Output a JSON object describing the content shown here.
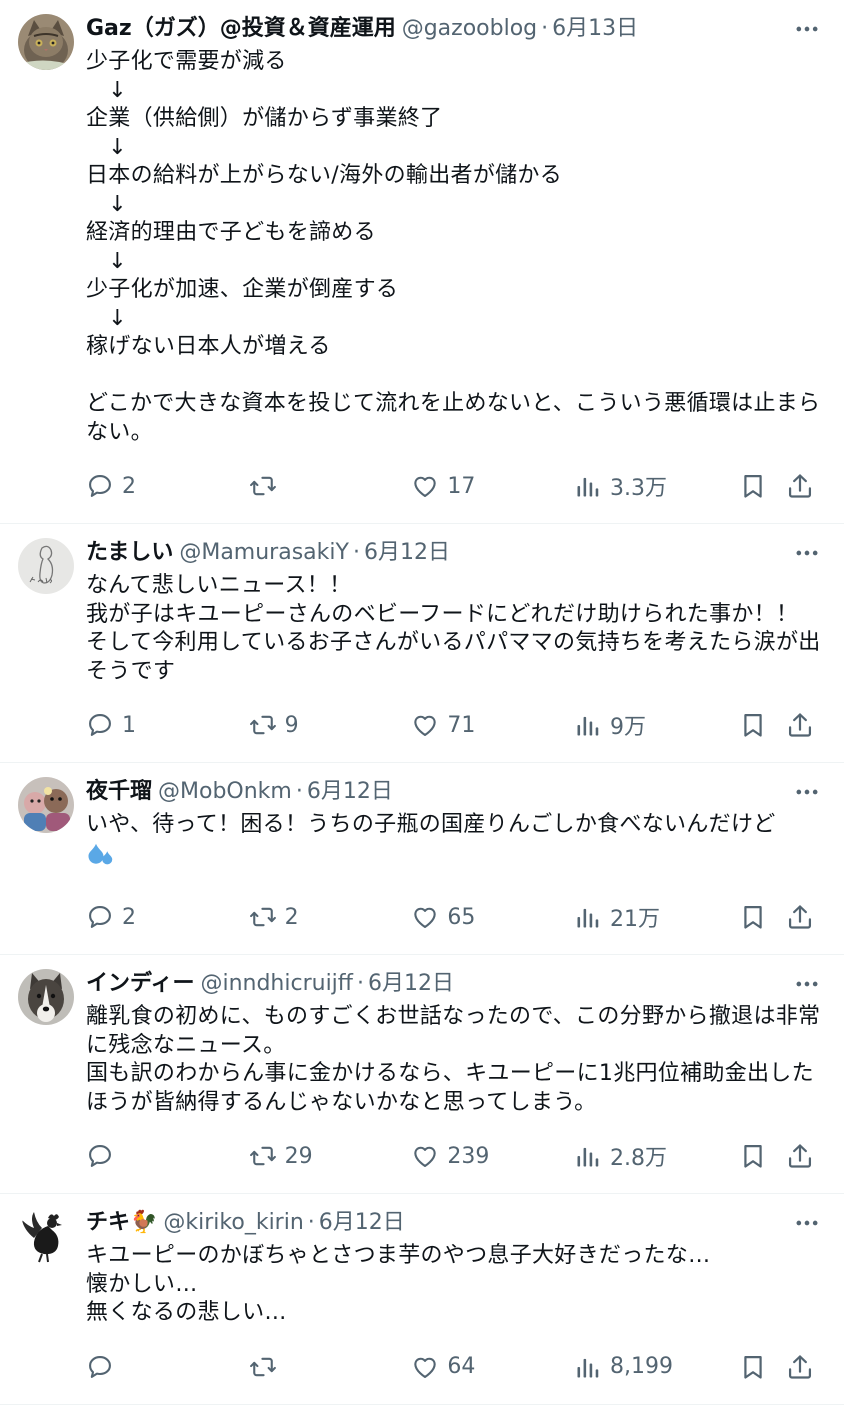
{
  "tweets": [
    {
      "name": "Gaz（ガズ）@投資＆資産運用",
      "handle": "@gazooblog",
      "sep": "·",
      "date": "6月13日",
      "text": "少子化で需要が減る\n　↓\n企業（供給側）が儲からず事業終了\n　↓\n日本の給料が上がらない/海外の輸出者が儲かる\n　↓\n経済的理由で子どもを諦める\n　↓\n少子化が加速、企業が倒産する\n　↓\n稼げない日本人が増える\n\nどこかで大きな資本を投じて流れを止めないと、こういう悪循環は止まらない。",
      "replies": "2",
      "retweets": "",
      "likes": "17",
      "views": "3.3万",
      "avatar": "cat"
    },
    {
      "name": "たましい",
      "handle": "@MamurasakiY",
      "sep": "·",
      "date": "6月12日",
      "text": "なんて悲しいニュース！！\n我が子はキユーピーさんのベビーフードにどれだけ助けられた事か！！\nそして今利用しているお子さんがいるパパママの気持ちを考えたら涙が出そうです",
      "replies": "1",
      "retweets": "9",
      "likes": "71",
      "views": "9万",
      "avatar": "sketch"
    },
    {
      "name": "夜千瑠",
      "handle": "@MobOnkm",
      "sep": "·",
      "date": "6月12日",
      "text": "いや、待って！困る！うちの子瓶の国産りんごしか食べないんだけど",
      "replies": "2",
      "retweets": "2",
      "likes": "65",
      "views": "21万",
      "avatar": "toys",
      "emoji": "sweat-droplets"
    },
    {
      "name": "インディー",
      "handle": "@inndhicruijff",
      "sep": "·",
      "date": "6月12日",
      "text": "離乳食の初めに、ものすごくお世話なったので、この分野から撤退は非常に残念なニュース。\n国も訳のわからん事に金かけるなら、キユーピーに1兆円位補助金出したほうが皆納得するんじゃないかなと思ってしまう。",
      "replies": "",
      "retweets": "29",
      "likes": "239",
      "views": "2.8万",
      "avatar": "dog"
    },
    {
      "name": "チキ🐓",
      "handle": "@kiriko_kirin",
      "sep": "·",
      "date": "6月12日",
      "text": "キユーピーのかぼちゃとさつま芋のやつ息子大好きだったな…\n懐かしい…\n無くなるの悲しい…",
      "replies": "",
      "retweets": "",
      "likes": "64",
      "views": "8,199",
      "avatar": "rooster"
    }
  ]
}
